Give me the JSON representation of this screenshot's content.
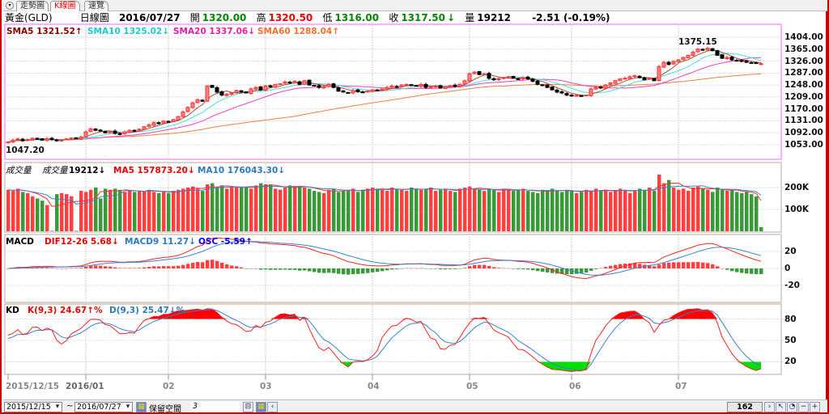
{
  "tabs": [
    {
      "label": "走勢圖",
      "active": false
    },
    {
      "label": "K線圖",
      "active": true
    },
    {
      "label": "速覽",
      "active": false
    }
  ],
  "info": {
    "name": "黃金(GLD)",
    "period": "日線圖",
    "date": "2016/07/27",
    "open_label": "開",
    "open": "1320.00",
    "high_label": "高",
    "high": "1320.50",
    "low_label": "低",
    "low": "1316.00",
    "close_label": "收",
    "close": "1317.50",
    "close_arrow": "↓",
    "vol_label": "量",
    "volume": "19212",
    "change": "-2.51 (-0.19%)"
  },
  "price_legend": {
    "sma5": "SMA5 1321.52↑",
    "sma10": "SMA10 1325.02↓",
    "sma20": "SMA20 1337.06↓",
    "sma60": "SMA60 1288.04↑",
    "high_mark": "1375.15",
    "low_mark": "1047.20"
  },
  "volume_legend": {
    "title": "成交量",
    "vol_label": "成交量",
    "vol": "19212↓",
    "ma5": "MA5 157873.20↓",
    "ma10": "MA10 176043.30↓"
  },
  "macd_legend": {
    "title": "MACD",
    "dif": "DIF12-26 5.68↓",
    "macd": "MACD9 11.27↓",
    "osc": "OSC -5.59↑"
  },
  "kd_legend": {
    "title": "KD",
    "k": "K(9,3) 24.67↑%",
    "d": "D(9,3) 25.47↓%"
  },
  "axes": {
    "price": [
      "1404.00",
      "1365.00",
      "1326.00",
      "1287.00",
      "1248.00",
      "1209.00",
      "1170.00",
      "1131.00",
      "1092.00",
      "1053.00"
    ],
    "volume": [
      "200K",
      "100K"
    ],
    "macd": [
      "20",
      "0",
      "-20"
    ],
    "kd": [
      "80",
      "50",
      "20"
    ]
  },
  "x_labels": [
    "2015/12/15",
    "2016/01",
    "02",
    "03",
    "04",
    "05",
    "06",
    "07"
  ],
  "bottom": {
    "from": "2015/12/15",
    "to": "2016/07/27",
    "reserve_label": "保留空間",
    "reserve_value": "3",
    "bar_count": "162"
  },
  "colors": {
    "up": "#ff3030",
    "down": "#000000",
    "vol_up": "#ff4040",
    "vol_down": "#3a9a3a",
    "sma5": "#a0522d",
    "sma10": "#40e0e0",
    "sma20": "#f040c0",
    "sma60": "#f08040"
  },
  "chart_data": {
    "type": "candlestick",
    "closes": [
      1062,
      1068,
      1072,
      1066,
      1070,
      1074,
      1071,
      1068,
      1073,
      1070,
      1066,
      1068,
      1072,
      1075,
      1074,
      1078,
      1095,
      1105,
      1100,
      1098,
      1092,
      1096,
      1090,
      1088,
      1095,
      1100,
      1098,
      1104,
      1112,
      1118,
      1125,
      1122,
      1130,
      1128,
      1135,
      1145,
      1160,
      1175,
      1190,
      1200,
      1195,
      1245,
      1240,
      1225,
      1215,
      1218,
      1222,
      1230,
      1225,
      1222,
      1235,
      1240,
      1232,
      1245,
      1242,
      1250,
      1252,
      1258,
      1255,
      1260,
      1250,
      1262,
      1248,
      1245,
      1240,
      1243,
      1250,
      1240,
      1228,
      1225,
      1222,
      1230,
      1226,
      1225,
      1228,
      1232,
      1230,
      1235,
      1240,
      1245,
      1242,
      1248,
      1250,
      1246,
      1245,
      1250,
      1240,
      1242,
      1245,
      1238,
      1242,
      1246,
      1244,
      1250,
      1262,
      1285,
      1290,
      1282,
      1285,
      1270,
      1265,
      1268,
      1272,
      1275,
      1270,
      1268,
      1272,
      1268,
      1260,
      1250,
      1248,
      1240,
      1232,
      1225,
      1222,
      1215,
      1212,
      1214,
      1212,
      1215,
      1235,
      1240,
      1238,
      1248,
      1255,
      1262,
      1268,
      1270,
      1275,
      1278,
      1272,
      1265,
      1270,
      1262,
      1308,
      1322,
      1315,
      1325,
      1330,
      1338,
      1345,
      1355,
      1365,
      1362,
      1368,
      1360,
      1345,
      1335,
      1338,
      1330,
      1328,
      1325,
      1322,
      1320,
      1318,
      1317.5
    ],
    "volumes_k": [
      190,
      185,
      195,
      180,
      175,
      160,
      150,
      140,
      120,
      2,
      170,
      175,
      170,
      160,
      2,
      185,
      180,
      190,
      200,
      150,
      195,
      190,
      195,
      190,
      180,
      185,
      180,
      185,
      185,
      190,
      180,
      175,
      180,
      175,
      185,
      190,
      195,
      200,
      205,
      195,
      185,
      215,
      220,
      200,
      210,
      195,
      205,
      205,
      200,
      200,
      195,
      210,
      220,
      215,
      215,
      195,
      190,
      200,
      210,
      205,
      205,
      200,
      195,
      185,
      180,
      175,
      190,
      195,
      180,
      185,
      190,
      195,
      180,
      190,
      195,
      200,
      195,
      190,
      185,
      200,
      195,
      190,
      185,
      200,
      195,
      190,
      195,
      200,
      185,
      190,
      195,
      185,
      180,
      195,
      200,
      205,
      195,
      190,
      185,
      195,
      190,
      180,
      195,
      190,
      185,
      190,
      195,
      185,
      180,
      175,
      190,
      185,
      195,
      185,
      180,
      190,
      185,
      175,
      180,
      190,
      185,
      195,
      185,
      190,
      180,
      185,
      195,
      190,
      175,
      185,
      195,
      190,
      200,
      185,
      260,
      220,
      235,
      200,
      190,
      195,
      185,
      200,
      205,
      195,
      190,
      180,
      200,
      190,
      185,
      190,
      180,
      175,
      180,
      170,
      160,
      19
    ],
    "ylim_price": [
      1040,
      1415
    ],
    "x_month_starts": {
      "2016/01": 16,
      "02": 33,
      "03": 53,
      "04": 75,
      "05": 95,
      "06": 116,
      "07": 138
    }
  }
}
